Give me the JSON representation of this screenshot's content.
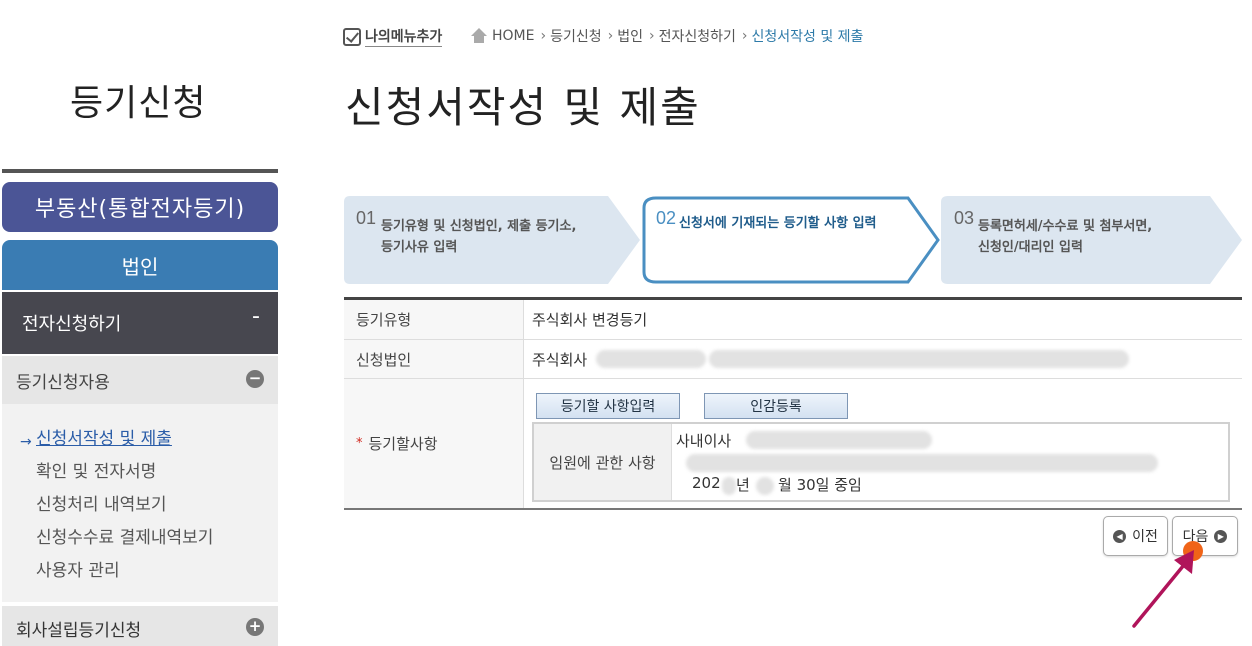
{
  "sidebar": {
    "title": "등기신청",
    "realestate_button": "부동산(통합전자등기)",
    "corp_button": "법인",
    "e_filing": {
      "label": "전자신청하기",
      "toggle": "-"
    },
    "applicant": {
      "label": "등기신청자용",
      "toggle": "−"
    },
    "items": [
      {
        "label": "신청서작성 및 제출",
        "active": true
      },
      {
        "label": "확인 및 전자서명"
      },
      {
        "label": "신청처리 내역보기"
      },
      {
        "label": "신청수수료 결제내역보기"
      },
      {
        "label": "사용자 관리"
      }
    ],
    "company_setup": {
      "label": "회사설립등기신청",
      "toggle": "+"
    }
  },
  "header": {
    "my_menu": "나의메뉴추가",
    "breadcrumb": [
      "HOME",
      "등기신청",
      "법인",
      "전자신청하기",
      "신청서작성 및 제출"
    ],
    "page_title": "신청서작성 및 제출"
  },
  "steps": [
    {
      "num": "01",
      "line1": "등기유형 및 신청법인, 제출 등기소,",
      "line2": "등기사유 입력",
      "active": false
    },
    {
      "num": "02",
      "line1": "신청서에 기재되는 등기할 사항 입력",
      "line2": "",
      "active": true
    },
    {
      "num": "03",
      "line1": "등록면허세/수수료 및 첨부서면,",
      "line2": "신청인/대리인 입력",
      "active": false
    }
  ],
  "form": {
    "reg_type": {
      "label": "등기유형",
      "value": "주식회사 변경등기"
    },
    "corp": {
      "label": "신청법인",
      "value": "주식회사"
    },
    "items": {
      "label": "등기할사항",
      "required_mark": "*",
      "btn_input": "등기할 사항입력",
      "btn_seal": "인감등록",
      "sub_label": "임원에 관한 사항",
      "line1": "사내이사",
      "line3_a": "202",
      "line3_b": "년",
      "line3_c": "월 30일 중임"
    }
  },
  "nav": {
    "prev": "이전",
    "next": "다음"
  },
  "colors": {
    "step_active_border": "#4a8fc2",
    "step_bg": "#dce6f0",
    "step_active_text": "#1f5c8b",
    "sidebar_dark": "#47474f",
    "realestate": "#4b5596",
    "corp": "#3a7cb3"
  }
}
